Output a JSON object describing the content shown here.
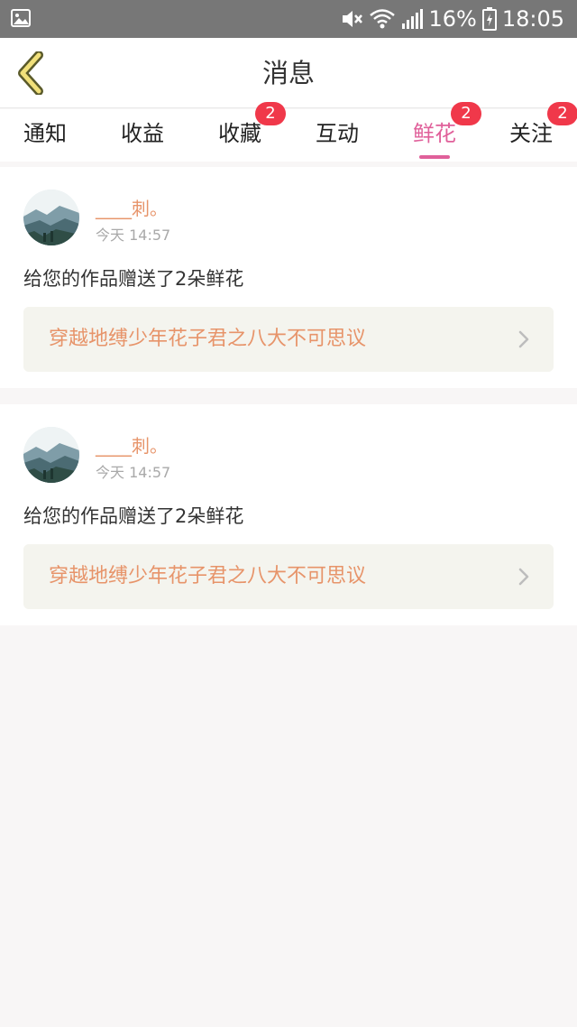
{
  "status_bar": {
    "battery": "16%",
    "time": "18:05",
    "icons": [
      "image-icon",
      "mute-icon",
      "wifi-icon",
      "signal-icon",
      "battery-icon"
    ]
  },
  "header": {
    "title": "消息",
    "back_icon": "chevron-left-icon"
  },
  "tabs": [
    {
      "label": "通知",
      "badge": ""
    },
    {
      "label": "收益",
      "badge": ""
    },
    {
      "label": "收藏",
      "badge": "2"
    },
    {
      "label": "互动",
      "badge": ""
    },
    {
      "label": "鲜花",
      "badge": "2",
      "active": true
    },
    {
      "label": "关注",
      "badge": "2"
    }
  ],
  "notifications": [
    {
      "username": "____刺。",
      "time": "今天 14:57",
      "message": "给您的作品赠送了2朵鲜花",
      "work_title": "穿越地缚少年花子君之八大不可思议"
    },
    {
      "username": "____刺。",
      "time": "今天 14:57",
      "message": "给您的作品赠送了2朵鲜花",
      "work_title": "穿越地缚少年花子君之八大不可思议"
    }
  ],
  "colors": {
    "accent_pink": "#e0609a",
    "badge_red": "#f0384a",
    "username_orange": "#e7946a",
    "link_bg": "#f4f4ee"
  }
}
